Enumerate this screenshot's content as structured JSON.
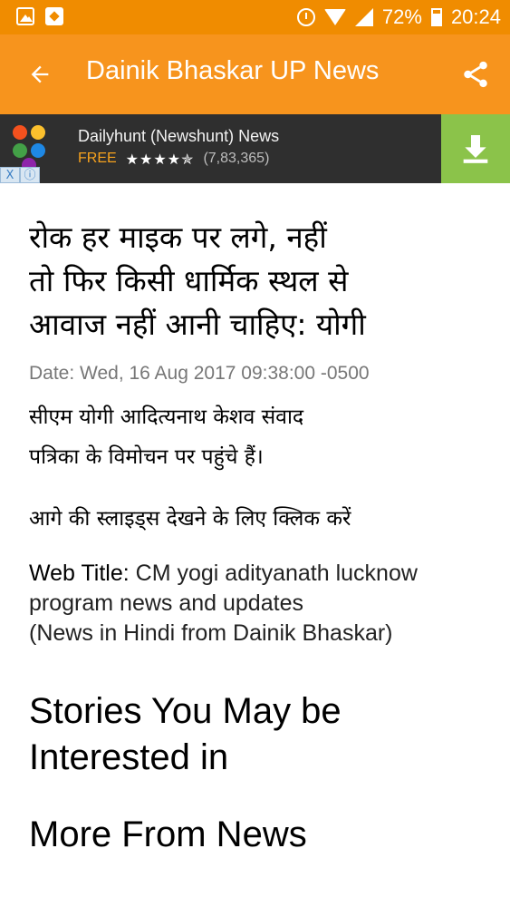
{
  "status_bar": {
    "battery_percent": "72%",
    "time": "20:24",
    "icons": [
      "gallery-icon",
      "app-notification-icon",
      "alarm-icon",
      "wifi-icon",
      "signal-icon",
      "battery-icon"
    ]
  },
  "app_bar": {
    "title": "Dainik Bhaskar UP News",
    "back_icon": "arrow-left-icon",
    "share_icon": "share-icon",
    "color": "#f7941d"
  },
  "ad": {
    "app_name": "Dailyhunt (Newshunt) News",
    "price": "FREE",
    "stars": "★★★★✯",
    "rating_count": "(7,83,365)",
    "download_icon": "download-icon",
    "choices": [
      "X",
      "ⓘ"
    ]
  },
  "article": {
    "headline_lines": [
      "रोक हर माइक पर लगे, नहीं",
      "तो फिर किसी धार्मिक स्थल से",
      "आवाज नहीं आनी चाहिए: योगी"
    ],
    "date": "Date: Wed, 16 Aug 2017 09:38:00 -0500",
    "body_lines": [
      "सीएम योगी आदित्यनाथ केशव संवाद",
      "पत्रिका के विमोचन पर पहुंचे हैं।"
    ],
    "cta": "आगे की स्लाइड्स देखने के लिए क्लिक करें",
    "web_title_label": "Web Title:",
    "web_title_lines": [
      "CM yogi adityanath lucknow",
      "program news and updates",
      "(News in Hindi from Dainik Bhaskar)"
    ]
  },
  "sections": {
    "stories_lines": [
      "Stories You May be",
      "Interested in"
    ],
    "more": "More From News"
  }
}
